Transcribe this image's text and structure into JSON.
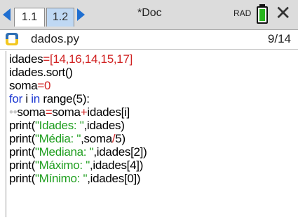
{
  "tabs": [
    {
      "label": "1.1",
      "active": true
    },
    {
      "label": "1.2",
      "active": false
    }
  ],
  "document_title": "*Doc",
  "angle_mode": "RAD",
  "icons": {
    "nav_left": "left-arrow-icon",
    "nav_right": "right-arrow-icon",
    "battery": "battery-icon",
    "close": "close-icon",
    "python": "python-file-icon"
  },
  "close_glyph": "✕",
  "colors": {
    "keyword": "#1a35d1",
    "string": "#1f9e1f",
    "operator": "#d02020",
    "tab_active_bg": "#ffffff",
    "tab_inactive_bg": "#bfd8f3",
    "battery": "#28b51e"
  },
  "file": {
    "name": "dados.py",
    "page": "9/14"
  },
  "code": {
    "l1": {
      "a": "idades",
      "b": "=",
      "c": "[14,16,14,15,17]"
    },
    "l2": {
      "a": "idades.sort()"
    },
    "l3": {
      "a": "soma",
      "b": "=",
      "c": "0"
    },
    "l4": {
      "a": "for",
      "b": " i ",
      "c": "in",
      "d": " range(5):"
    },
    "l5": {
      "dots": "••",
      "a": "soma",
      "b": "=",
      "c": "soma",
      "d": "+",
      "e": "idades[i]"
    },
    "l6": {
      "a": "print(",
      "b": "\"Idades: \"",
      "c": ",idades)"
    },
    "l7": {
      "a": "print(",
      "b": "\"Média: \"",
      "c": ",soma",
      "d": "/",
      "e": "5)"
    },
    "l8": {
      "a": "print(",
      "b": "\"Mediana: \"",
      "c": ",idades[2])"
    },
    "l9": {
      "a": "print(",
      "b": "\"Máximo: \"",
      "c": ",idades[4])"
    },
    "l10": {
      "a": "print(",
      "b": "\"Mínimo: \"",
      "c": ",idades[0])"
    }
  }
}
